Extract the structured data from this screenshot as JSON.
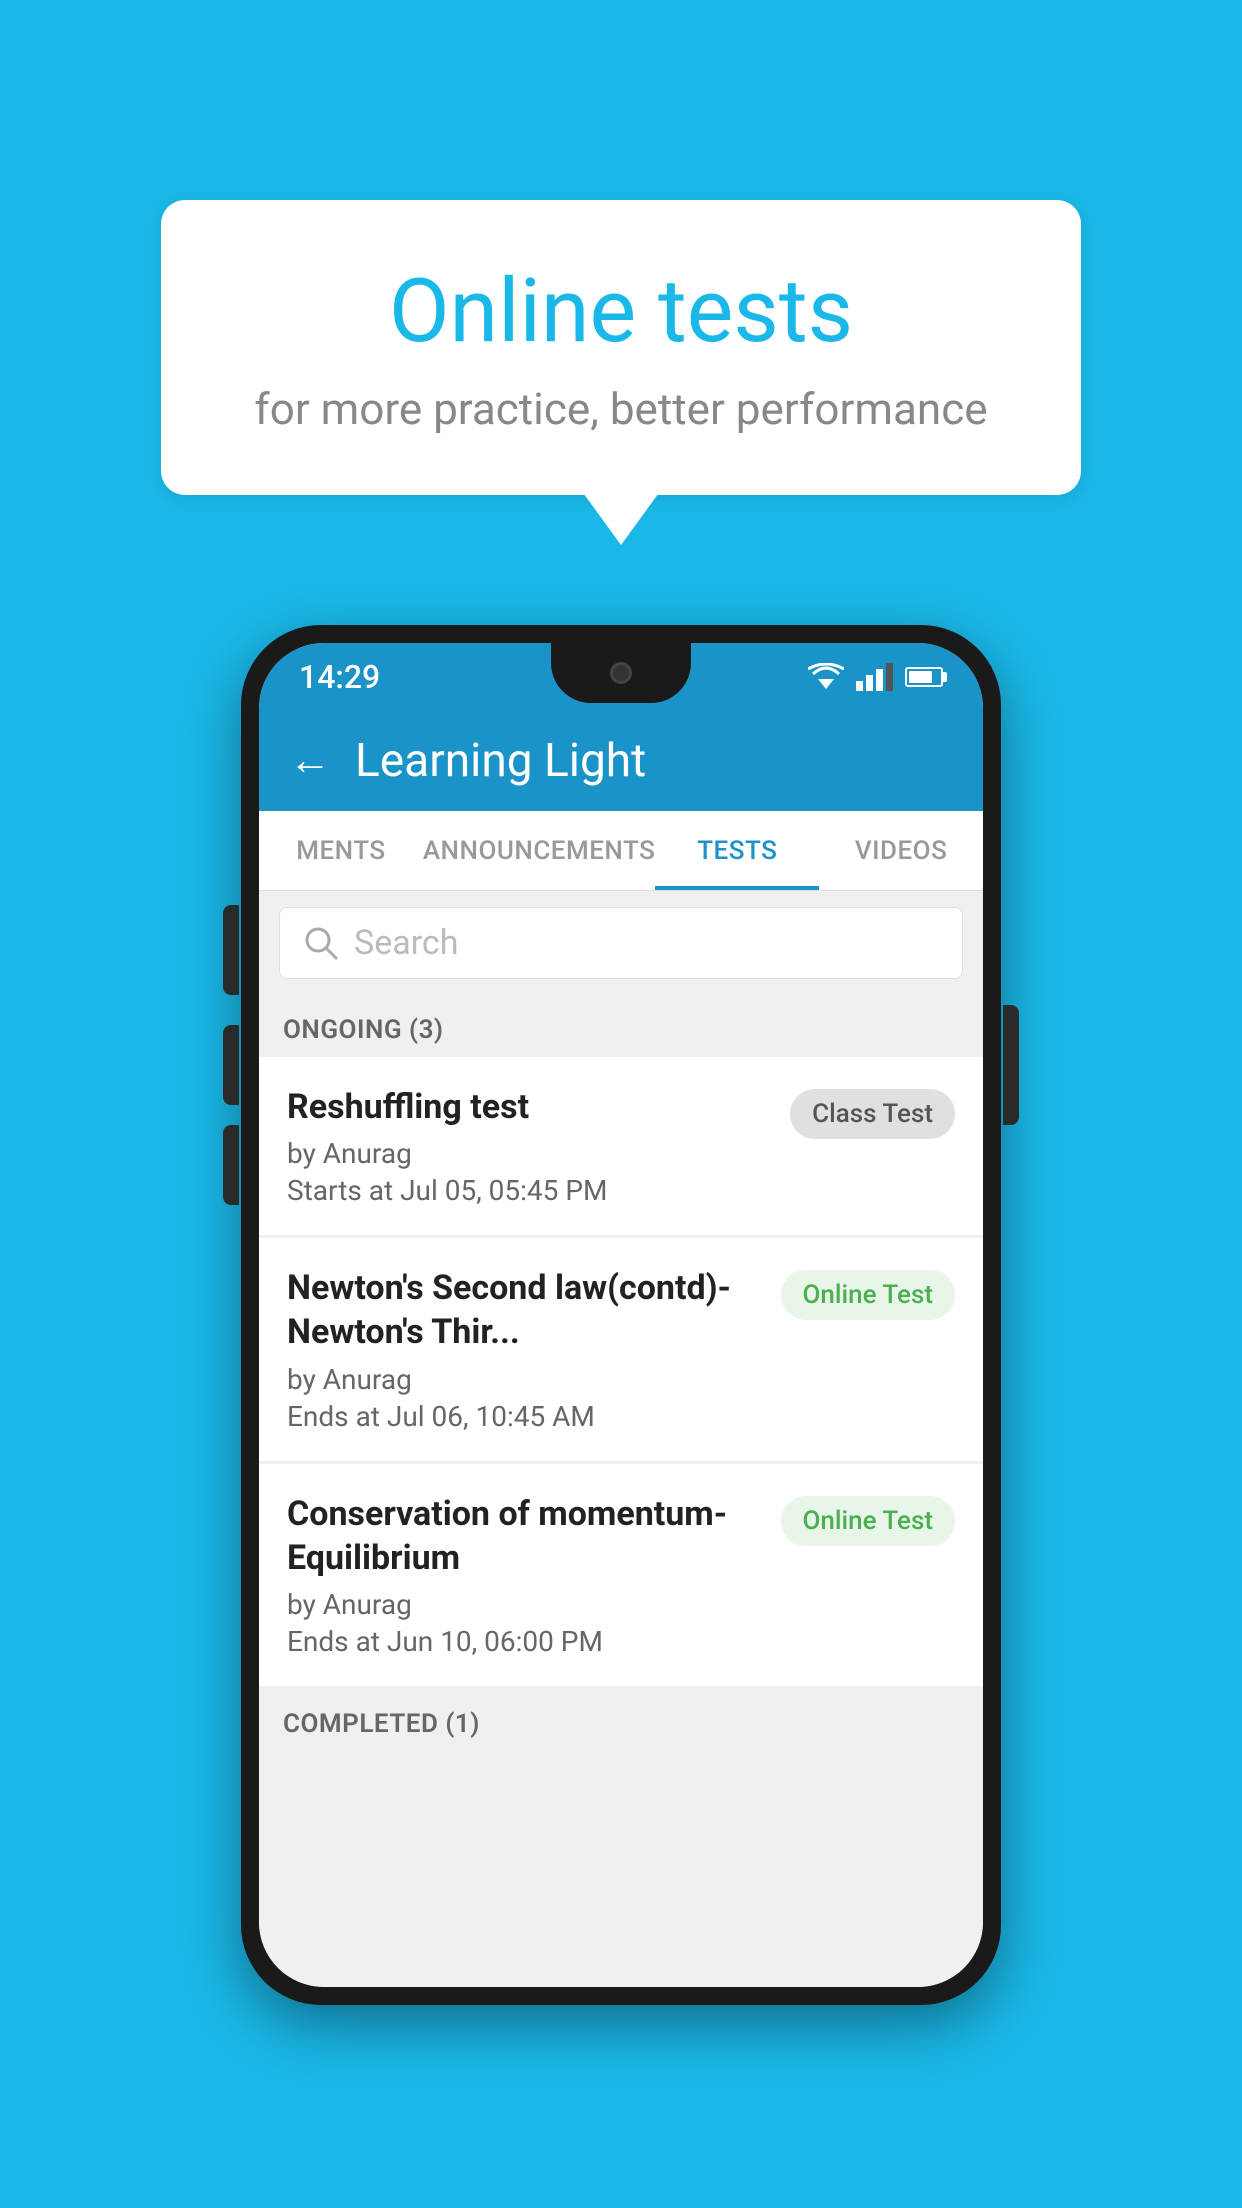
{
  "background_color": "#1ab8e8",
  "speech_bubble": {
    "title": "Online tests",
    "subtitle": "for more practice, better performance"
  },
  "phone": {
    "status_bar": {
      "time": "14:29"
    },
    "app_bar": {
      "title": "Learning Light",
      "back_label": "←"
    },
    "tabs": [
      {
        "id": "ments",
        "label": "MENTS",
        "active": false
      },
      {
        "id": "announcements",
        "label": "ANNOUNCEMENTS",
        "active": false
      },
      {
        "id": "tests",
        "label": "TESTS",
        "active": true
      },
      {
        "id": "videos",
        "label": "VIDEOS",
        "active": false
      }
    ],
    "search": {
      "placeholder": "Search"
    },
    "ongoing_section": {
      "header": "ONGOING (3)",
      "items": [
        {
          "title": "Reshuffling test",
          "by": "by Anurag",
          "date": "Starts at  Jul 05, 05:45 PM",
          "badge": "Class Test",
          "badge_type": "class"
        },
        {
          "title": "Newton's Second law(contd)-Newton's Thir...",
          "by": "by Anurag",
          "date": "Ends at  Jul 06, 10:45 AM",
          "badge": "Online Test",
          "badge_type": "online"
        },
        {
          "title": "Conservation of momentum-Equilibrium",
          "by": "by Anurag",
          "date": "Ends at  Jun 10, 06:00 PM",
          "badge": "Online Test",
          "badge_type": "online"
        }
      ]
    },
    "completed_section": {
      "header": "COMPLETED (1)"
    }
  }
}
